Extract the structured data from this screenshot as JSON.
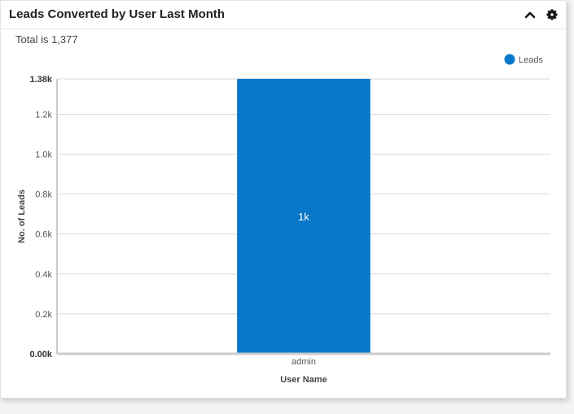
{
  "header": {
    "title": "Leads Converted by User Last Month",
    "collapse_icon": "chevron-up-icon",
    "settings_icon": "gear-icon"
  },
  "summary": {
    "total_text": "Total is 1,377"
  },
  "colors": {
    "bar": "#0677c9",
    "grid": "#d9d9d9",
    "axis": "#cccccc"
  },
  "chart_data": {
    "type": "bar",
    "title": "Leads Converted by User Last Month",
    "categories": [
      "admin"
    ],
    "series": [
      {
        "name": "Leads",
        "values": [
          1377
        ],
        "data_labels": [
          "1k"
        ]
      }
    ],
    "xlabel": "User Name",
    "ylabel": "No. of Leads",
    "ylim": [
      0,
      1377
    ],
    "yticks": [
      {
        "value": 0,
        "label": "0.00k",
        "bold": true
      },
      {
        "value": 200,
        "label": "0.2k",
        "bold": false
      },
      {
        "value": 400,
        "label": "0.4k",
        "bold": false
      },
      {
        "value": 600,
        "label": "0.6k",
        "bold": false
      },
      {
        "value": 800,
        "label": "0.8k",
        "bold": false
      },
      {
        "value": 1000,
        "label": "1.0k",
        "bold": false
      },
      {
        "value": 1200,
        "label": "1.2k",
        "bold": false
      },
      {
        "value": 1377,
        "label": "1.38k",
        "bold": true
      }
    ],
    "grid": true,
    "legend": {
      "position": "top-right",
      "entries": [
        "Leads"
      ]
    }
  }
}
